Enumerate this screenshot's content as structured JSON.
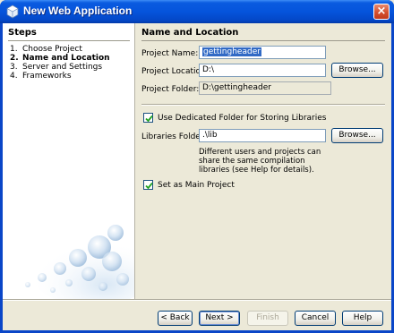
{
  "window": {
    "title": "New Web Application",
    "close_label": "×"
  },
  "steps": {
    "title": "Steps",
    "items": [
      {
        "num": "1.",
        "label": "Choose Project"
      },
      {
        "num": "2.",
        "label": "Name and Location"
      },
      {
        "num": "3.",
        "label": "Server and Settings"
      },
      {
        "num": "4.",
        "label": "Frameworks"
      }
    ],
    "current_index": 1
  },
  "main": {
    "section_title": "Name and Location",
    "project_name_label": "Project Name:",
    "project_name_value": "gettingheader",
    "project_location_label": "Project Location:",
    "project_location_value": "D:\\",
    "project_folder_label": "Project Folder:",
    "project_folder_value": "D:\\gettingheader",
    "browse_label": "Browse...",
    "dedicated_folder_label": "Use Dedicated Folder for Storing Libraries",
    "dedicated_folder_checked": true,
    "libraries_folder_label": "Libraries Folder:",
    "libraries_folder_value": ".\\lib",
    "libraries_note": "Different users and projects can share the same compilation libraries (see Help for details).",
    "main_project_label": "Set as Main Project",
    "main_project_checked": true
  },
  "buttons": {
    "back": "< Back",
    "next": "Next >",
    "finish": "Finish",
    "cancel": "Cancel",
    "help": "Help"
  },
  "colors": {
    "titlebar": "#0554dc",
    "selection": "#316ac5",
    "window_bg": "#ece9d8"
  }
}
